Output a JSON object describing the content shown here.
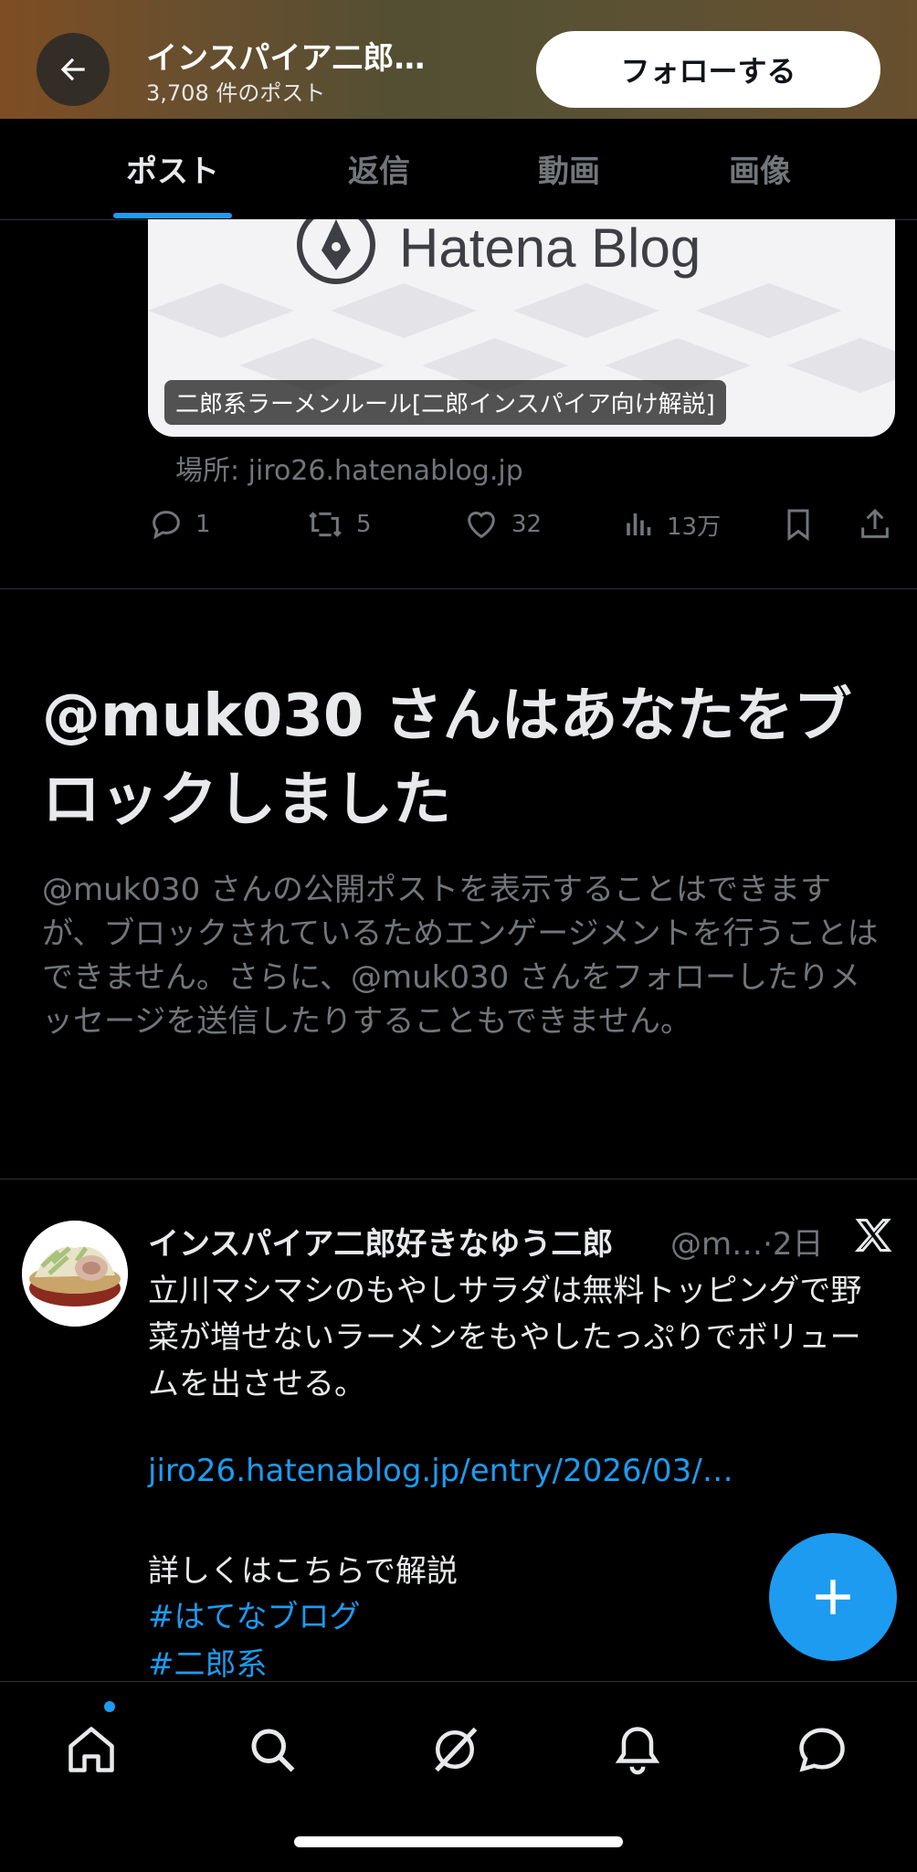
{
  "header": {
    "title": "インスパイア二郎…",
    "post_count": "3,708 件のポスト",
    "follow_label": "フォローする"
  },
  "tabs": [
    {
      "label": "ポスト",
      "active": true
    },
    {
      "label": "返信",
      "active": false
    },
    {
      "label": "動画",
      "active": false
    },
    {
      "label": "画像",
      "active": false
    }
  ],
  "card": {
    "logo_text": "Hatena Blog",
    "caption": "二郎系ラーメンルール[二郎インスパイア向け解説]",
    "source": "場所: jiro26.hatenablog.jp"
  },
  "actions": {
    "replies": "1",
    "reposts": "5",
    "likes": "32",
    "views": "13万"
  },
  "block_notice": {
    "title": "@muk030 さんはあなたをブロックしました",
    "body": "@muk030 さんの公開ポストを表示することはできますが、ブロックされているためエンゲージメントを行うことはできません。さらに、@muk030 さんをフォローしたりメッセージを送信したりすることもできません。"
  },
  "tweet": {
    "author_name": "インスパイア二郎好きなゆう二郎",
    "handle_time": "@m…·2日",
    "text": "立川マシマシのもやしサラダは無料トッピングで野菜が増せないラーメンをもやしたっぷりでボリュームを出させる。",
    "link": "jiro26.hatenablog.jp/entry/2026/03/…",
    "more_text": "詳しくはこちらで解説",
    "hashtags": [
      "#はてなブログ",
      "#二郎系"
    ]
  },
  "colors": {
    "accent": "#1d9bf0",
    "background": "#000000",
    "muted": "#71767b",
    "text": "#e7e9ea"
  },
  "bottom_nav": [
    "home-icon",
    "search-icon",
    "grok-icon",
    "bell-icon",
    "messages-icon"
  ]
}
